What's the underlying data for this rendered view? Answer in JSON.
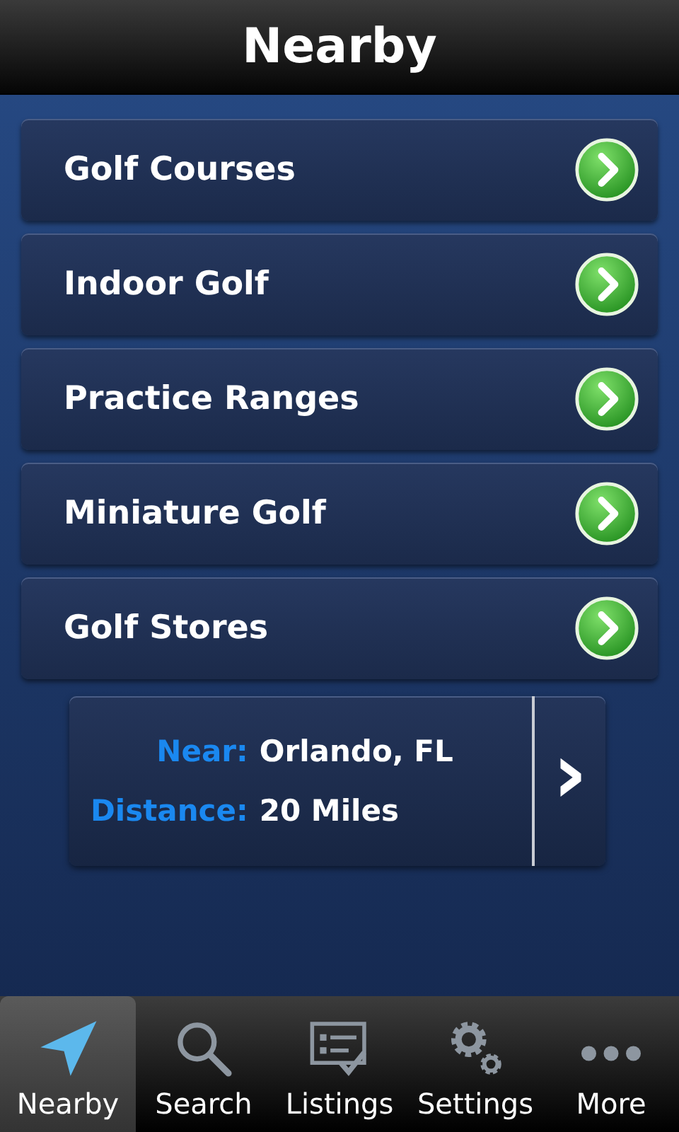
{
  "header": {
    "title": "Nearby"
  },
  "categories": [
    {
      "label": "Golf Courses"
    },
    {
      "label": "Indoor Golf"
    },
    {
      "label": "Practice Ranges"
    },
    {
      "label": "Miniature Golf"
    },
    {
      "label": "Golf Stores"
    }
  ],
  "location": {
    "fields": [
      {
        "label": "Near:",
        "value": "Orlando, FL"
      },
      {
        "label": "Distance:",
        "value": "20 Miles"
      }
    ],
    "arrow": "›"
  },
  "tabs": [
    {
      "label": "Nearby",
      "kind": "arrow",
      "selected": true
    },
    {
      "label": "Search",
      "kind": "search",
      "selected": false
    },
    {
      "label": "Listings",
      "kind": "list",
      "selected": false
    },
    {
      "label": "Settings",
      "kind": "gear",
      "selected": false
    },
    {
      "label": "More",
      "kind": "dots",
      "selected": false
    }
  ]
}
